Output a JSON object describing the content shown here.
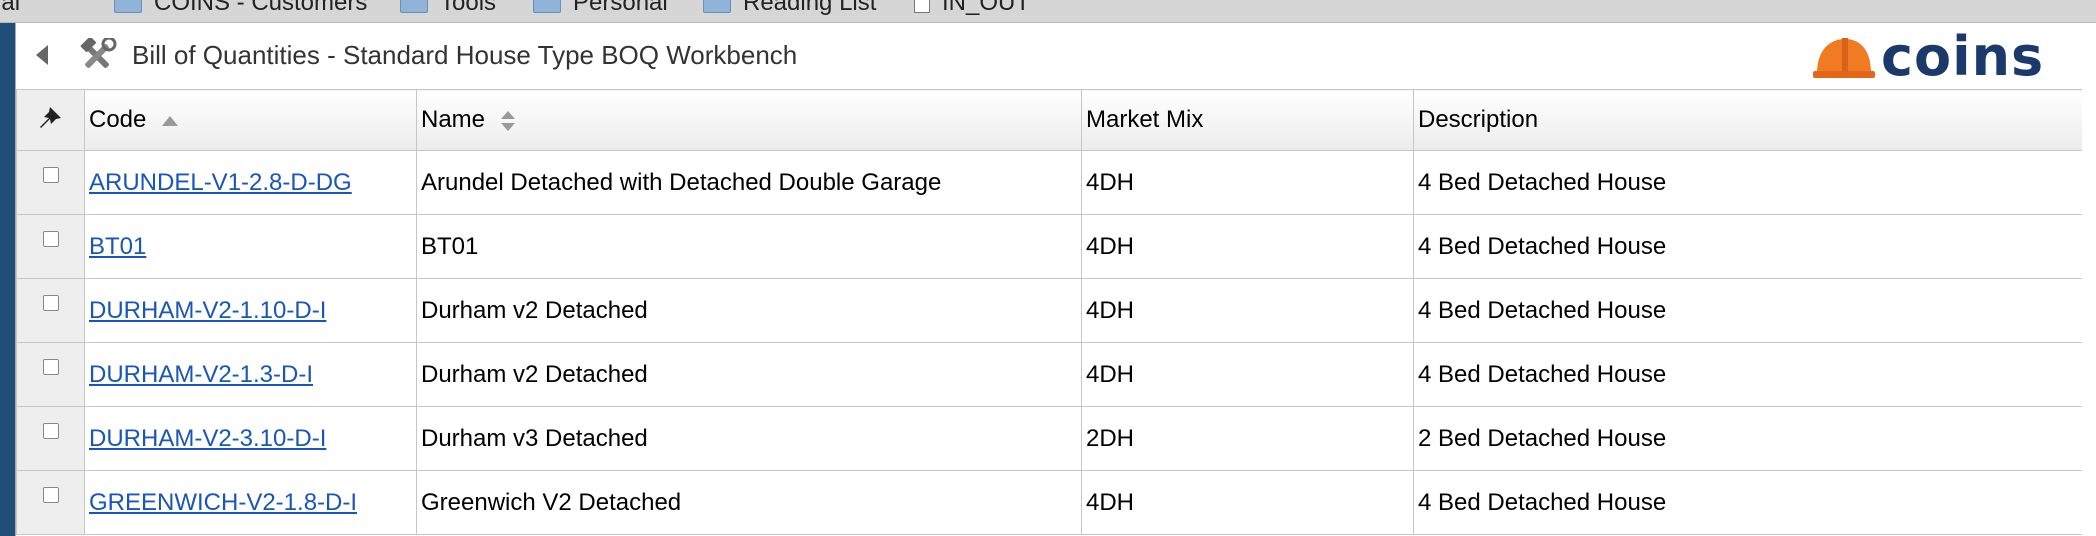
{
  "bookmarks": [
    {
      "label": "Internal",
      "icon": "none"
    },
    {
      "label": "COINS - Customers",
      "icon": "folder-icon"
    },
    {
      "label": "Tools",
      "icon": "folder-icon"
    },
    {
      "label": "Personal",
      "icon": "folder-icon"
    },
    {
      "label": "Reading List",
      "icon": "folder-icon"
    },
    {
      "label": "IN_OUT",
      "icon": "document-icon"
    }
  ],
  "header": {
    "title": "Bill of Quantities - Standard House Type BOQ Workbench",
    "back_icon": "back-arrow-icon",
    "tools_icon": "hammer-wrench-icon",
    "logo_text": "coins"
  },
  "table": {
    "columns": [
      {
        "key": "pin",
        "label": ""
      },
      {
        "key": "code",
        "label": "Code",
        "sort": "asc"
      },
      {
        "key": "name",
        "label": "Name",
        "sort": "both"
      },
      {
        "key": "market_mix",
        "label": "Market Mix"
      },
      {
        "key": "description",
        "label": "Description"
      }
    ],
    "rows": [
      {
        "code": "ARUNDEL-V1-2.8-D-DG",
        "name": "Arundel Detached with Detached Double Garage",
        "market_mix": "4DH",
        "description": "4 Bed Detached House"
      },
      {
        "code": "BT01",
        "name": "BT01",
        "market_mix": "4DH",
        "description": "4 Bed Detached House"
      },
      {
        "code": "DURHAM-V2-1.10-D-I",
        "name": "Durham v2 Detached",
        "market_mix": "4DH",
        "description": "4 Bed Detached House"
      },
      {
        "code": "DURHAM-V2-1.3-D-I",
        "name": "Durham v2 Detached",
        "market_mix": "4DH",
        "description": "4 Bed Detached House"
      },
      {
        "code": "DURHAM-V2-3.10-D-I",
        "name": "Durham v3 Detached",
        "market_mix": "2DH",
        "description": "2 Bed Detached House"
      },
      {
        "code": "GREENWICH-V2-1.8-D-I",
        "name": "Greenwich V2 Detached",
        "market_mix": "4DH",
        "description": "4 Bed Detached House"
      }
    ]
  },
  "colors": {
    "link": "#1a56b8",
    "logo_text": "#1b3a6b",
    "logo_helmet": "#f07b22",
    "left_strip": "#1f4e79"
  }
}
